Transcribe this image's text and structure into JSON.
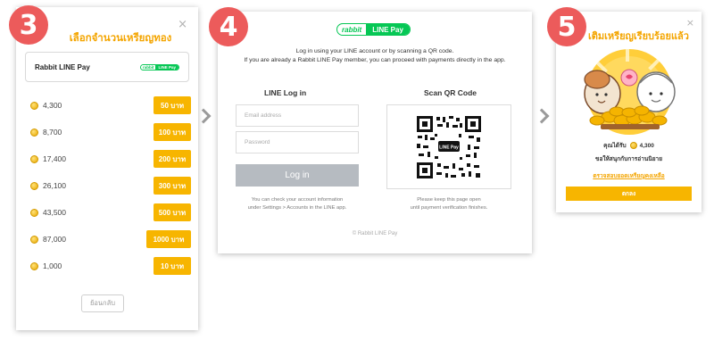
{
  "steps": [
    "3",
    "4",
    "5"
  ],
  "panel3": {
    "title": "เลือกจำนวนเหรียญทอง",
    "close": "×",
    "merchant_name": "Rabbit LINE Pay",
    "logo_rabbit": "rabbit",
    "logo_linepay": "LINE Pay",
    "options": [
      {
        "amount": "4,300",
        "price": "50 บาท"
      },
      {
        "amount": "8,700",
        "price": "100 บาท"
      },
      {
        "amount": "17,400",
        "price": "200 บาท"
      },
      {
        "amount": "26,100",
        "price": "300 บาท"
      },
      {
        "amount": "43,500",
        "price": "500 บาท"
      },
      {
        "amount": "87,000",
        "price": "1000 บาท"
      },
      {
        "amount": "1,000",
        "price": "10 บาท"
      }
    ],
    "back_label": "ย้อนกลับ"
  },
  "panel4": {
    "brand_rabbit": "rabbit",
    "brand_linepay": "LINE Pay",
    "intro_line1": "Log in using your LINE account or by scanning a QR code.",
    "intro_line2": "If you are already a Rabbit LINE Pay member, you can proceed with payments directly in the app.",
    "login_title": "LINE Log in",
    "qr_title": "Scan QR Code",
    "email_placeholder": "Email address",
    "password_placeholder": "Password",
    "login_button": "Log in",
    "login_note_1": "You can check your account information",
    "login_note_2": "under Settings > Accounts in the LINE app.",
    "qr_note_1": "Please keep this page open",
    "qr_note_2": "until payment verification finishes.",
    "qr_badge": "LINE Pay",
    "footer": "© Rabbit LINE Pay"
  },
  "panel5": {
    "title": "เติมเหรียญเรียบร้อยแล้ว",
    "close": "×",
    "received_label": "คุณได้รับ",
    "received_amount": "4,300",
    "enjoy_text": "ขอให้สนุกกับการอ่านนิยาย",
    "balance_link": "ตรวจสอบยอดเหรียญคงเหลือ",
    "ok_button": "ตกลง"
  },
  "colors": {
    "accent": "#f7b500",
    "title": "#f4a500",
    "badge": "#ec5b5b",
    "line_green": "#06c755",
    "disabled_button": "#b6bbc1"
  },
  "icons": [
    "coin-icon",
    "close-icon",
    "chevron-right-icon",
    "qr-code-icon"
  ]
}
